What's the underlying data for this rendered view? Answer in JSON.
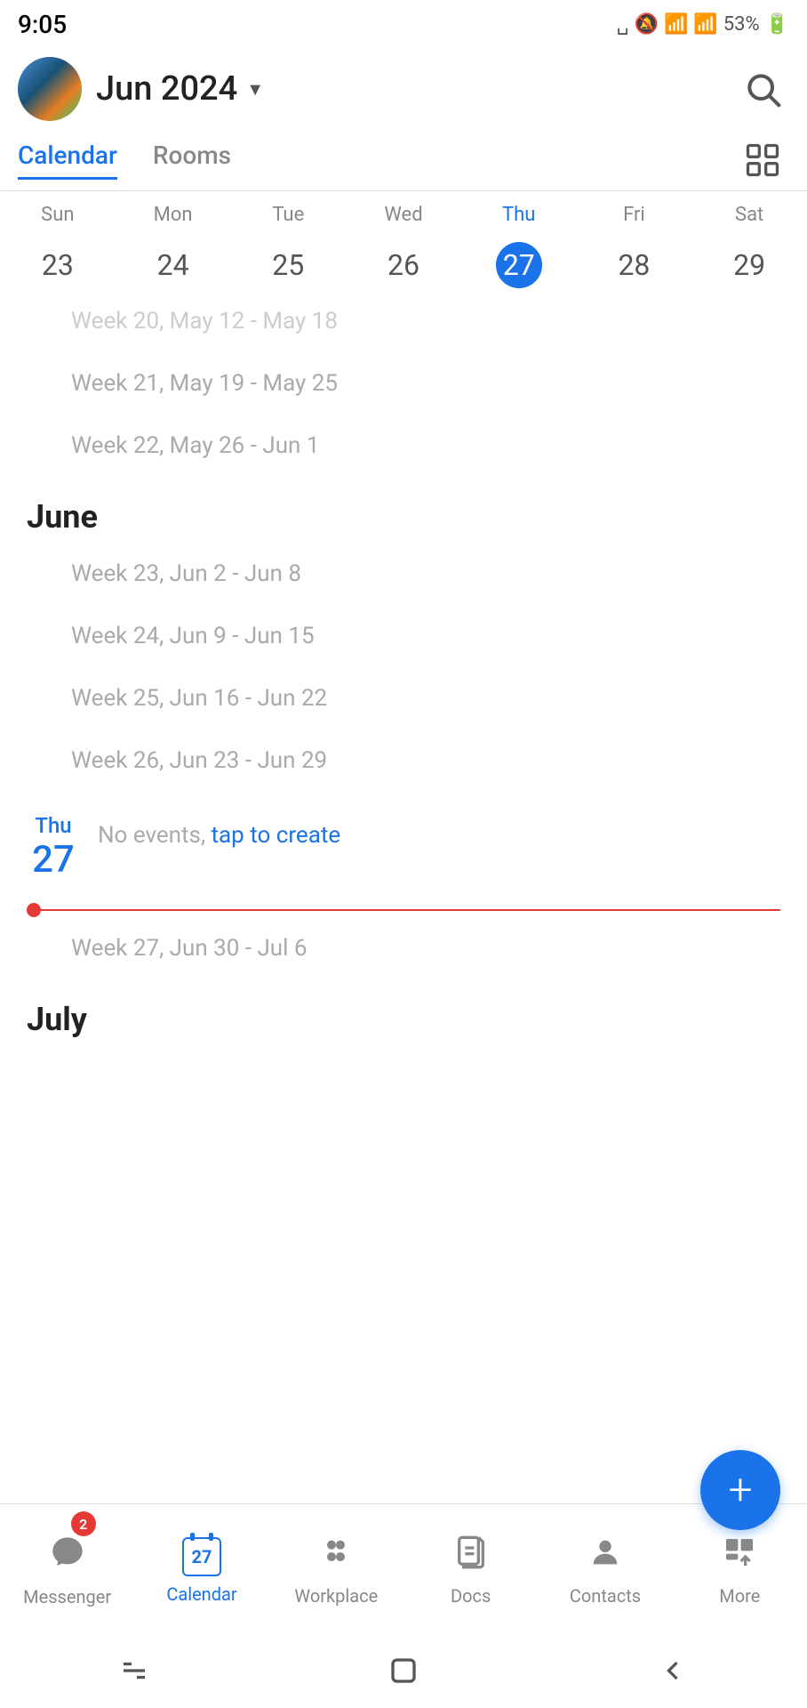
{
  "status": {
    "time": "9:05",
    "battery": "53%"
  },
  "header": {
    "month_title": "Jun 2024",
    "dropdown_label": "▾"
  },
  "tabs": [
    {
      "id": "calendar",
      "label": "Calendar",
      "active": true
    },
    {
      "id": "rooms",
      "label": "Rooms",
      "active": false
    }
  ],
  "days_of_week": [
    {
      "label": "Sun",
      "today": false
    },
    {
      "label": "Mon",
      "today": false
    },
    {
      "label": "Tue",
      "today": false
    },
    {
      "label": "Wed",
      "today": false
    },
    {
      "label": "Thu",
      "today": true
    },
    {
      "label": "Fri",
      "today": false
    },
    {
      "label": "Sat",
      "today": false
    }
  ],
  "dates": [
    {
      "num": "23",
      "today": false
    },
    {
      "num": "24",
      "today": false
    },
    {
      "num": "25",
      "today": false
    },
    {
      "num": "26",
      "today": false
    },
    {
      "num": "27",
      "today": true
    },
    {
      "num": "28",
      "today": false
    },
    {
      "num": "29",
      "today": false
    }
  ],
  "weeks_above": [
    {
      "label": "Week 20, May 12 - May 18"
    },
    {
      "label": "Week 21, May 19 - May 25"
    },
    {
      "label": "Week 22, May 26 - Jun 1"
    }
  ],
  "june_weeks": [
    {
      "label": "Week 23, Jun 2 - Jun 8"
    },
    {
      "label": "Week 24, Jun 9 - Jun 15"
    },
    {
      "label": "Week 25, Jun 16 - Jun 22"
    },
    {
      "label": "Week 26, Jun 23 - Jun 29"
    }
  ],
  "today_section": {
    "dow": "Thu",
    "num": "27",
    "no_events_text": "No events,",
    "tap_link": "tap to create"
  },
  "july_weeks": [
    {
      "label": "Week 27, Jun 30 - Jul 6"
    }
  ],
  "july_label": "July",
  "june_label": "June",
  "fab_label": "+",
  "bottom_nav": [
    {
      "id": "messenger",
      "label": "Messenger",
      "icon": "💬",
      "badge": "2",
      "active": false
    },
    {
      "id": "calendar",
      "label": "Calendar",
      "icon": "cal",
      "badge": null,
      "active": true
    },
    {
      "id": "workplace",
      "label": "Workplace",
      "icon": "⠿",
      "badge": null,
      "active": false
    },
    {
      "id": "docs",
      "label": "Docs",
      "icon": "📄",
      "badge": null,
      "active": false
    },
    {
      "id": "contacts",
      "label": "Contacts",
      "icon": "👤",
      "badge": null,
      "active": false
    },
    {
      "id": "more",
      "label": "More",
      "icon": "⠿",
      "badge": null,
      "active": false
    }
  ]
}
